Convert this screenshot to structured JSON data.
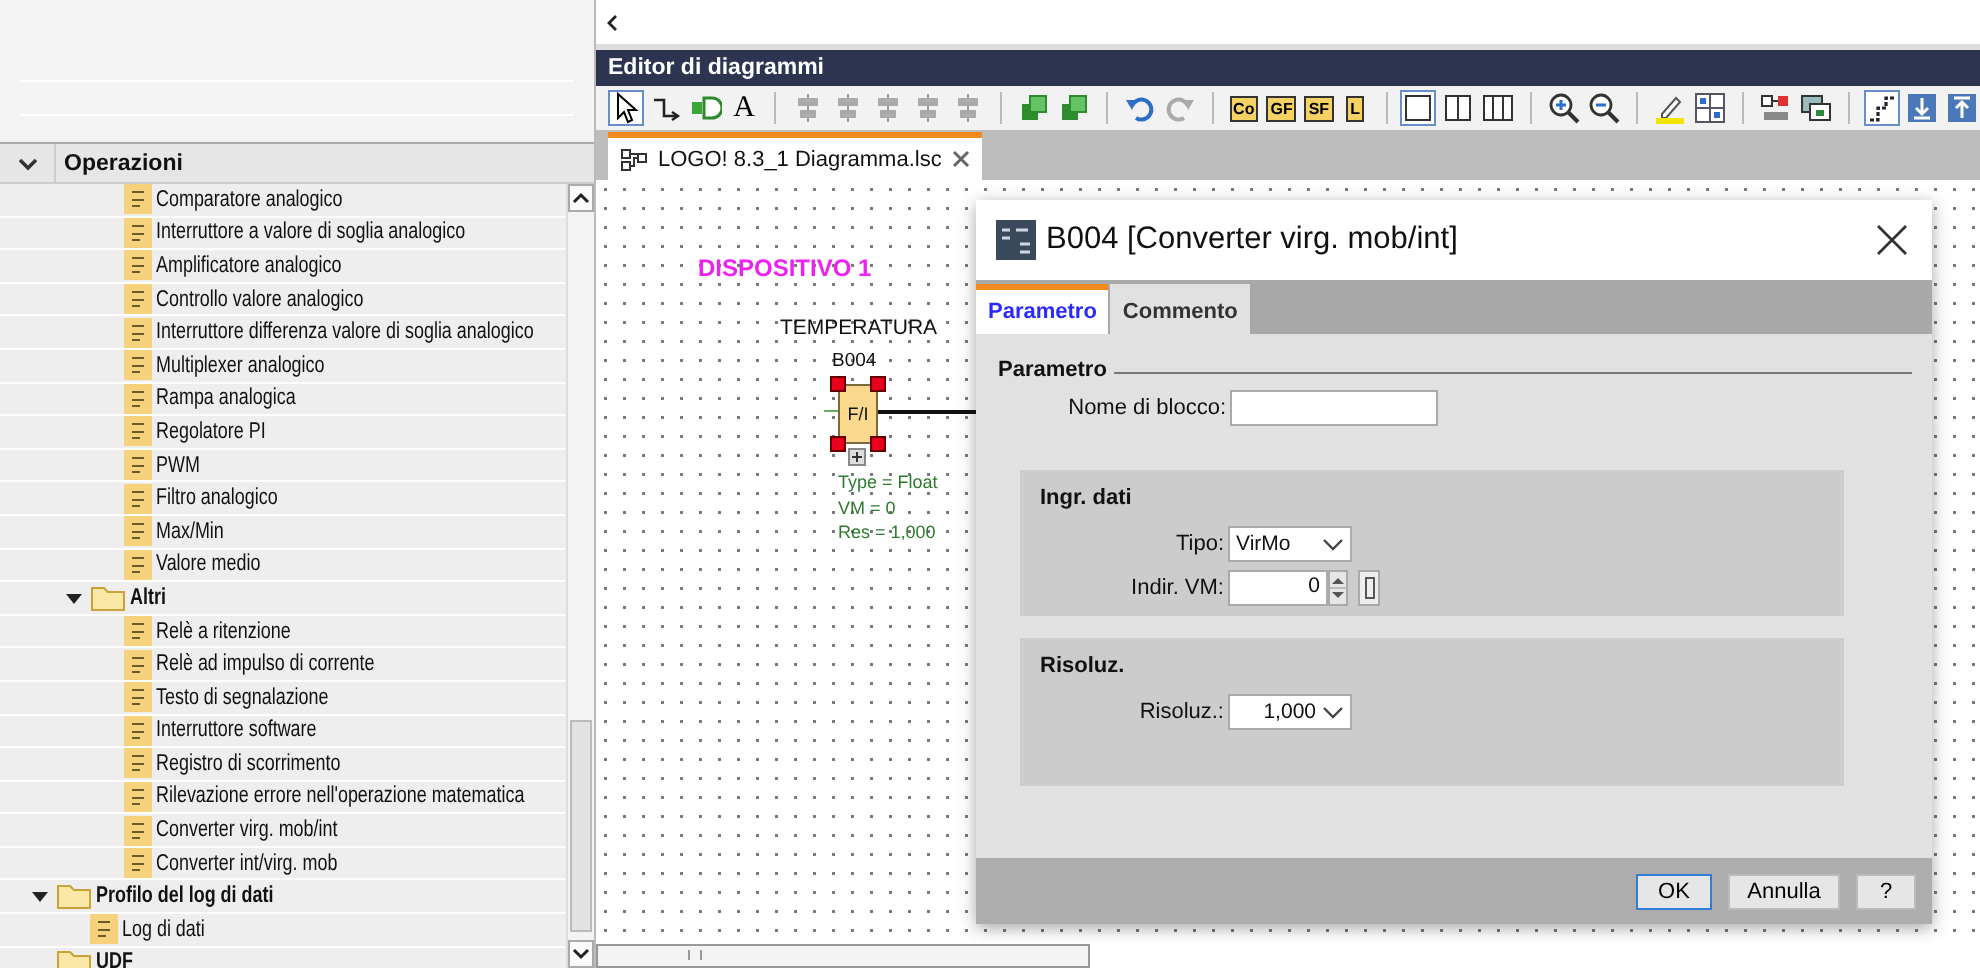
{
  "sidebar": {
    "section": {
      "title": "Operazioni",
      "expanded": true
    },
    "tree": [
      {
        "children": [
          {
            "children": [
              {
                "label": "Comparatore analogico",
                "kind": "block"
              },
              {
                "label": "Interruttore a valore di soglia analogico",
                "kind": "block"
              },
              {
                "label": "Amplificatore analogico",
                "kind": "block"
              },
              {
                "label": "Controllo valore analogico",
                "kind": "block"
              },
              {
                "label": "Interruttore differenza valore di soglia analogico",
                "kind": "block"
              },
              {
                "label": "Multiplexer analogico",
                "kind": "block"
              },
              {
                "label": "Rampa analogica",
                "kind": "block"
              },
              {
                "label": "Regolatore PI",
                "kind": "block"
              },
              {
                "label": "PWM",
                "kind": "block"
              },
              {
                "label": "Filtro analogico",
                "kind": "block"
              },
              {
                "label": "Max/Min",
                "kind": "block"
              },
              {
                "label": "Valore medio",
                "kind": "block"
              }
            ]
          },
          {
            "label": "Altri",
            "kind": "folder",
            "expanded": true,
            "children": [
              {
                "label": "Relè a ritenzione",
                "kind": "block"
              },
              {
                "label": "Relè ad impulso di corrente",
                "kind": "block"
              },
              {
                "label": "Testo di segnalazione",
                "kind": "block"
              },
              {
                "label": "Interruttore software",
                "kind": "block"
              },
              {
                "label": "Registro di scorrimento",
                "kind": "block"
              },
              {
                "label": "Rilevazione errore nell'operazione matematica",
                "kind": "block"
              },
              {
                "label": "Converter virg. mob/int",
                "kind": "block"
              },
              {
                "label": "Converter int/virg. mob",
                "kind": "block"
              }
            ]
          }
        ]
      },
      {
        "label": "Profilo del log di dati",
        "kind": "folder",
        "expanded": true,
        "children": [
          {
            "label": "Log di dati",
            "kind": "block"
          }
        ]
      },
      {
        "label": "UDF",
        "kind": "folder"
      }
    ]
  },
  "editor": {
    "title": "Editor di diagrammi",
    "toolbar": [
      [
        {
          "kind": "select",
          "selected": true
        },
        {
          "kind": "connect",
          "selected": false
        },
        {
          "kind": "block",
          "selected": false
        },
        {
          "kind": "text",
          "label": "A",
          "selected": false
        }
      ],
      [
        {
          "kind": "align",
          "selected": false
        },
        {
          "kind": "align",
          "selected": false
        },
        {
          "kind": "align",
          "selected": false
        },
        {
          "kind": "align",
          "selected": false
        },
        {
          "kind": "align",
          "selected": false
        }
      ],
      [
        {
          "kind": "layer",
          "selected": false
        },
        {
          "kind": "layer",
          "selected": false
        }
      ],
      [
        {
          "kind": "undo",
          "selected": false
        },
        {
          "kind": "redo",
          "selected": false
        }
      ],
      [
        {
          "kind": "label",
          "label": "Co",
          "selected": false
        },
        {
          "kind": "label",
          "label": "GF",
          "selected": false
        },
        {
          "kind": "label",
          "label": "SF",
          "selected": false
        },
        {
          "kind": "label",
          "label": "L",
          "selected": false
        }
      ],
      [
        {
          "kind": "layout1",
          "selected": true
        },
        {
          "kind": "layout2",
          "selected": false
        },
        {
          "kind": "layout3",
          "selected": false
        }
      ],
      [
        {
          "kind": "zoomin",
          "selected": false
        },
        {
          "kind": "zoomout",
          "selected": false
        }
      ],
      [
        {
          "kind": "highlight",
          "selected": false
        },
        {
          "kind": "grid",
          "selected": false
        }
      ],
      [
        {
          "kind": "sim",
          "selected": false
        },
        {
          "kind": "online",
          "selected": false
        }
      ],
      [
        {
          "kind": "step",
          "selected": true
        },
        {
          "kind": "down",
          "selected": false
        },
        {
          "kind": "up",
          "selected": false
        }
      ]
    ],
    "tabs": [
      {
        "label": "LOGO! 8.3_1 Diagramma.lsc",
        "selected": true
      }
    ]
  },
  "canvas": {
    "device_label": "DISPOSITIVO 1",
    "block": {
      "name": "TEMPERATURA",
      "id": "B004",
      "symbol": "F/I",
      "selected": true,
      "params": [
        "Type = Float",
        "VM = 0",
        "Res = 1,000"
      ]
    }
  },
  "dialog": {
    "title": "B004 [Converter virg. mob/int]",
    "tabs": [
      {
        "label": "Parametro",
        "selected": true
      },
      {
        "label": "Commento",
        "selected": false
      }
    ],
    "section": "Parametro",
    "name_field": {
      "label": "Nome di blocco:"
    },
    "groups": [
      {
        "title": "Ingr. dati",
        "fields": [
          {
            "kind": "select",
            "label": "Tipo:",
            "value": "VirMo"
          },
          {
            "kind": "spinner",
            "label": "Indir. VM:",
            "value": "0"
          }
        ]
      },
      {
        "title": "Risoluz.",
        "fields": [
          {
            "kind": "number-select",
            "label": "Risoluz.:",
            "value": "1,000"
          }
        ]
      }
    ],
    "buttons": [
      {
        "label": "OK",
        "kind": "default"
      },
      {
        "label": "Annulla",
        "kind": "plain"
      },
      {
        "label": "?",
        "kind": "plain"
      }
    ]
  }
}
